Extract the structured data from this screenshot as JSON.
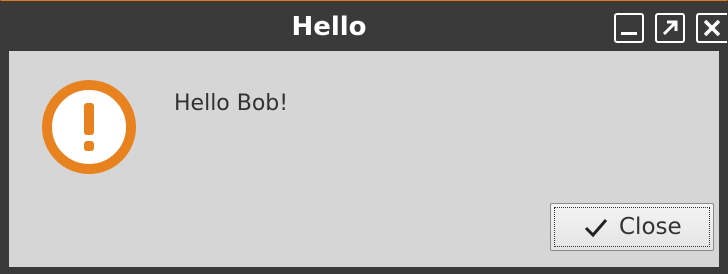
{
  "window": {
    "title": "Hello"
  },
  "dialog": {
    "icon": "warning-exclamation-icon",
    "message": "Hello Bob!",
    "close_button_label": "Close",
    "close_button_icon": "check-icon"
  },
  "colors": {
    "titlebar": "#3a3a3a",
    "accent": "#e8821f",
    "background": "#d6d6d6"
  }
}
